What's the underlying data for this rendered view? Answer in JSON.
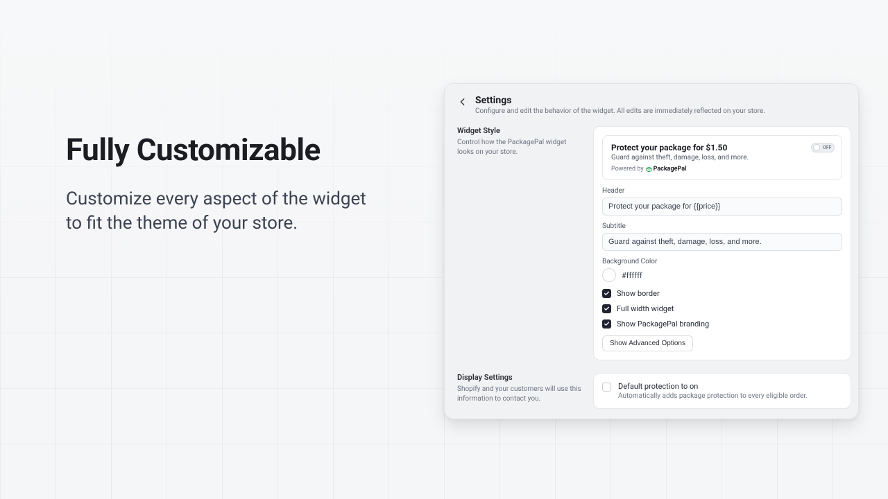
{
  "hero": {
    "title": "Fully Customizable",
    "subtitle": "Customize every aspect of the widget to fit the theme of your store."
  },
  "panel": {
    "title": "Settings",
    "subtitle": "Configure and edit the behavior of the widget. All edits are immediately reflected on your store."
  },
  "widgetStyle": {
    "title": "Widget Style",
    "desc": "Control how the PackagePal widget looks on your store.",
    "preview": {
      "title": "Protect your package for $1.50",
      "subtitle": "Guard against theft, damage, loss, and more.",
      "poweredPrefix": "Powered by",
      "brand": "PackagePal",
      "toggleLabel": "OFF"
    },
    "headerLabel": "Header",
    "headerValue": "Protect your package for {{price}}",
    "subtitleLabel": "Subtitle",
    "subtitleValue": "Guard against theft, damage, loss, and more.",
    "bgLabel": "Background Color",
    "bgValue": "#ffffff",
    "checks": {
      "showBorder": "Show border",
      "fullWidth": "Full width widget",
      "showBranding": "Show PackagePal branding"
    },
    "advancedBtn": "Show Advanced Options"
  },
  "displaySettings": {
    "title": "Display Settings",
    "desc": "Shopify and your customers will use this information to contact you.",
    "defaultOnLabel": "Default protection to on",
    "defaultOnDesc": "Automatically adds package protection to every eligible order."
  }
}
